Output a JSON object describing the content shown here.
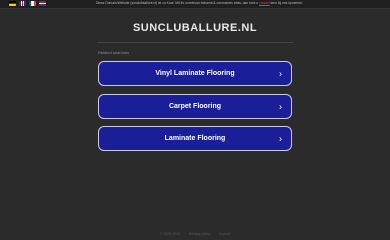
{
  "topbar": {
    "languages": [
      {
        "code": "de",
        "icon": "flag-germany-icon"
      },
      {
        "code": "gb",
        "icon": "flag-uk-icon"
      },
      {
        "code": "fr",
        "icon": "flag-france-icon"
      },
      {
        "code": "nl",
        "icon": "flag-netherlands-icon"
      }
    ],
    "notice_text": "Diese Domain/Website (sunclubsallure.nl) ist zu Kauf. Mit Ihr unrelevan bekannt & overnames erlas, dan kunt u",
    "notice_link": "contact",
    "notice_tail": "leen bij ons opnemen."
  },
  "header": {
    "site_title": "SUNCLUBALLURE.NL"
  },
  "related": {
    "label": "Related searches",
    "items": [
      {
        "label": "Vinyl Laminate Flooring"
      },
      {
        "label": "Carpet Flooring"
      },
      {
        "label": "Laminate Flooring"
      }
    ],
    "chevron": "›"
  },
  "footer": {
    "copyright": "© 2025 2025",
    "privacy": "Privacy policy",
    "imprint": "Imprint"
  },
  "colors": {
    "background": "#2b2b2b",
    "button": "#1a1f99",
    "button_border": "#c9cbe8"
  }
}
